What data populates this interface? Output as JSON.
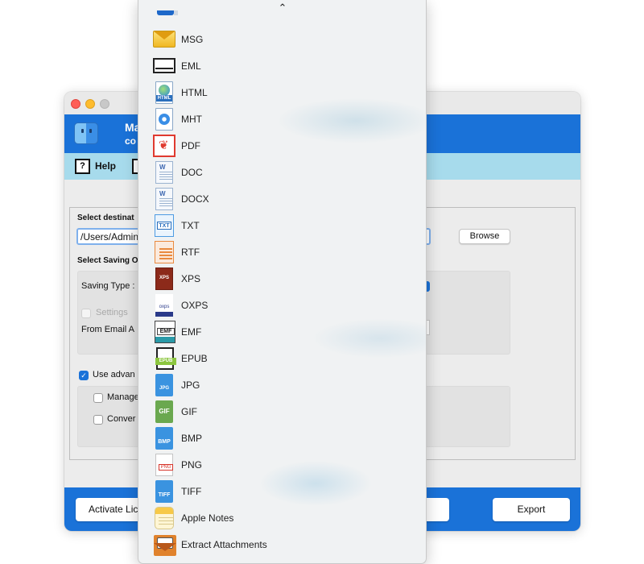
{
  "window": {
    "title_partial": "Ma",
    "subtitle_partial": "co",
    "toolbar": {
      "help_label": "Help"
    },
    "destination": {
      "label": "Select destinat",
      "path_value": "/Users/Admin",
      "browse_label": "Browse"
    },
    "saving": {
      "section_label": "Select Saving O",
      "saving_type_label": "Saving Type :",
      "settings_label": "Settings",
      "from_email_label": "From Email A"
    },
    "advanced": {
      "use_advanced_label": "Use advan",
      "manage_label": "Manage",
      "convert_label": "Conver"
    },
    "footer": {
      "activate_label": "Activate Lic",
      "export_label": "Export"
    }
  },
  "dropdown": {
    "scroll_up_glyph": "⌃",
    "items": [
      {
        "label": "MSG",
        "icon": "envelope-yellow-icon"
      },
      {
        "label": "EML",
        "icon": "envelope-outline-icon"
      },
      {
        "label": "HTML",
        "icon": "html-file-icon",
        "badge": "HTML"
      },
      {
        "label": "MHT",
        "icon": "mht-file-icon"
      },
      {
        "label": "PDF",
        "icon": "pdf-file-icon"
      },
      {
        "label": "DOC",
        "icon": "doc-file-icon"
      },
      {
        "label": "DOCX",
        "icon": "docx-file-icon"
      },
      {
        "label": "TXT",
        "icon": "txt-file-icon",
        "badge": "TXT"
      },
      {
        "label": "RTF",
        "icon": "rtf-file-icon"
      },
      {
        "label": "XPS",
        "icon": "xps-file-icon",
        "badge": "XPS"
      },
      {
        "label": "OXPS",
        "icon": "oxps-file-icon",
        "badge": "oxps"
      },
      {
        "label": "EMF",
        "icon": "emf-file-icon",
        "badge": "EMF"
      },
      {
        "label": "EPUB",
        "icon": "epub-file-icon",
        "badge": "EPUB"
      },
      {
        "label": "JPG",
        "icon": "jpg-file-icon",
        "badge": "JPG"
      },
      {
        "label": "GIF",
        "icon": "gif-file-icon",
        "badge": "GIF"
      },
      {
        "label": "BMP",
        "icon": "bmp-file-icon",
        "badge": "BMP"
      },
      {
        "label": "PNG",
        "icon": "png-file-icon",
        "badge": "PNG"
      },
      {
        "label": "TIFF",
        "icon": "tiff-file-icon",
        "badge": "TIFF"
      },
      {
        "label": "Apple Notes",
        "icon": "apple-notes-icon"
      },
      {
        "label": "Extract Attachments",
        "icon": "extract-attachments-icon"
      }
    ]
  },
  "colors": {
    "accent_blue": "#1a72d8",
    "toolbar_cyan": "#a7dbec",
    "pdf_red": "#e03a2f"
  }
}
